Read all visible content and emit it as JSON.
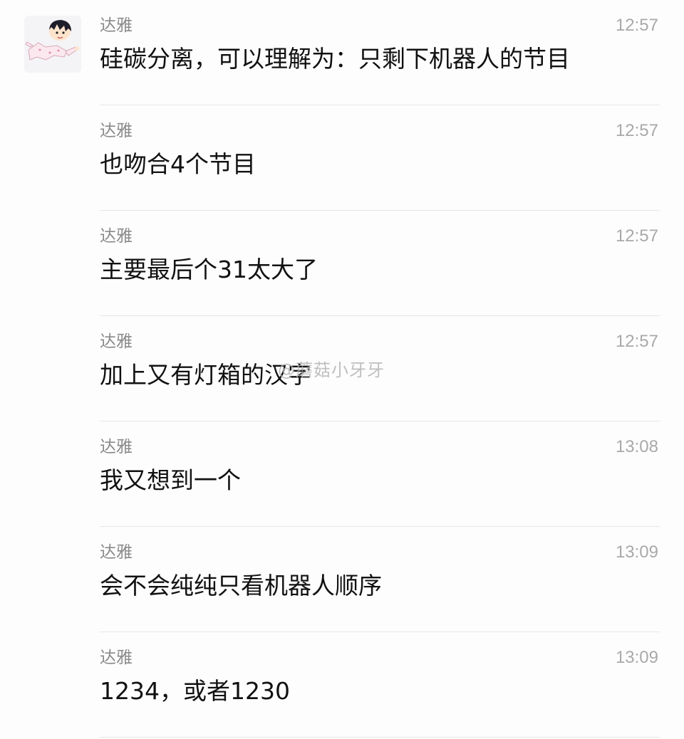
{
  "messages": [
    {
      "sender": "达雅",
      "time": "12:57",
      "text": "硅碳分离，可以理解为：只剩下机器人的节目",
      "has_avatar": true
    },
    {
      "sender": "达雅",
      "time": "12:57",
      "text": "也吻合4个节目"
    },
    {
      "sender": "达雅",
      "time": "12:57",
      "text": "主要最后个31太大了"
    },
    {
      "sender": "达雅",
      "time": "12:57",
      "text": "加上又有灯箱的汉字"
    },
    {
      "sender": "达雅",
      "time": "13:08",
      "text": "我又想到一个"
    },
    {
      "sender": "达雅",
      "time": "13:09",
      "text": "会不会纯纯只看机器人顺序"
    },
    {
      "sender": "达雅",
      "time": "13:09",
      "text": "1234，或者1230"
    }
  ],
  "watermark": "@蘑菇小牙牙",
  "avatar_icon": "cartoon-avatar-icon"
}
